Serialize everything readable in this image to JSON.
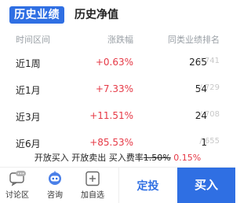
{
  "tabs": {
    "active": "历史业绩",
    "inactive": "历史净值"
  },
  "table": {
    "headers": {
      "period": "时间区间",
      "change": "涨跌幅",
      "rank": "同类业绩排名"
    },
    "rows": [
      {
        "period": "近1周",
        "change": "+0.63%",
        "rank": "265",
        "total": "/ 741"
      },
      {
        "period": "近1月",
        "change": "+7.33%",
        "rank": "54",
        "total": "/ 729"
      },
      {
        "period": "近3月",
        "change": "+11.51%",
        "rank": "24",
        "total": "/ 708"
      },
      {
        "period": "近6月",
        "change": "+85.53%",
        "rank": "1",
        "total": "/ 655"
      }
    ]
  },
  "buy_info": {
    "open_buy": "开放买入",
    "open_sell": "开放卖出",
    "fee_label": "买入费率",
    "fee_original": "1.50%",
    "fee_current": "0.15%"
  },
  "bottom_bar": {
    "discuss": "讨论区",
    "consult": "咨询",
    "watchlist": "加自选",
    "ding": "定投",
    "buy": "买入"
  },
  "colors": {
    "accent": "#2f6fe3",
    "up": "#e63946"
  },
  "icons": [
    "chat-bubble-icon",
    "assistant-robot-icon",
    "add-watchlist-icon"
  ]
}
